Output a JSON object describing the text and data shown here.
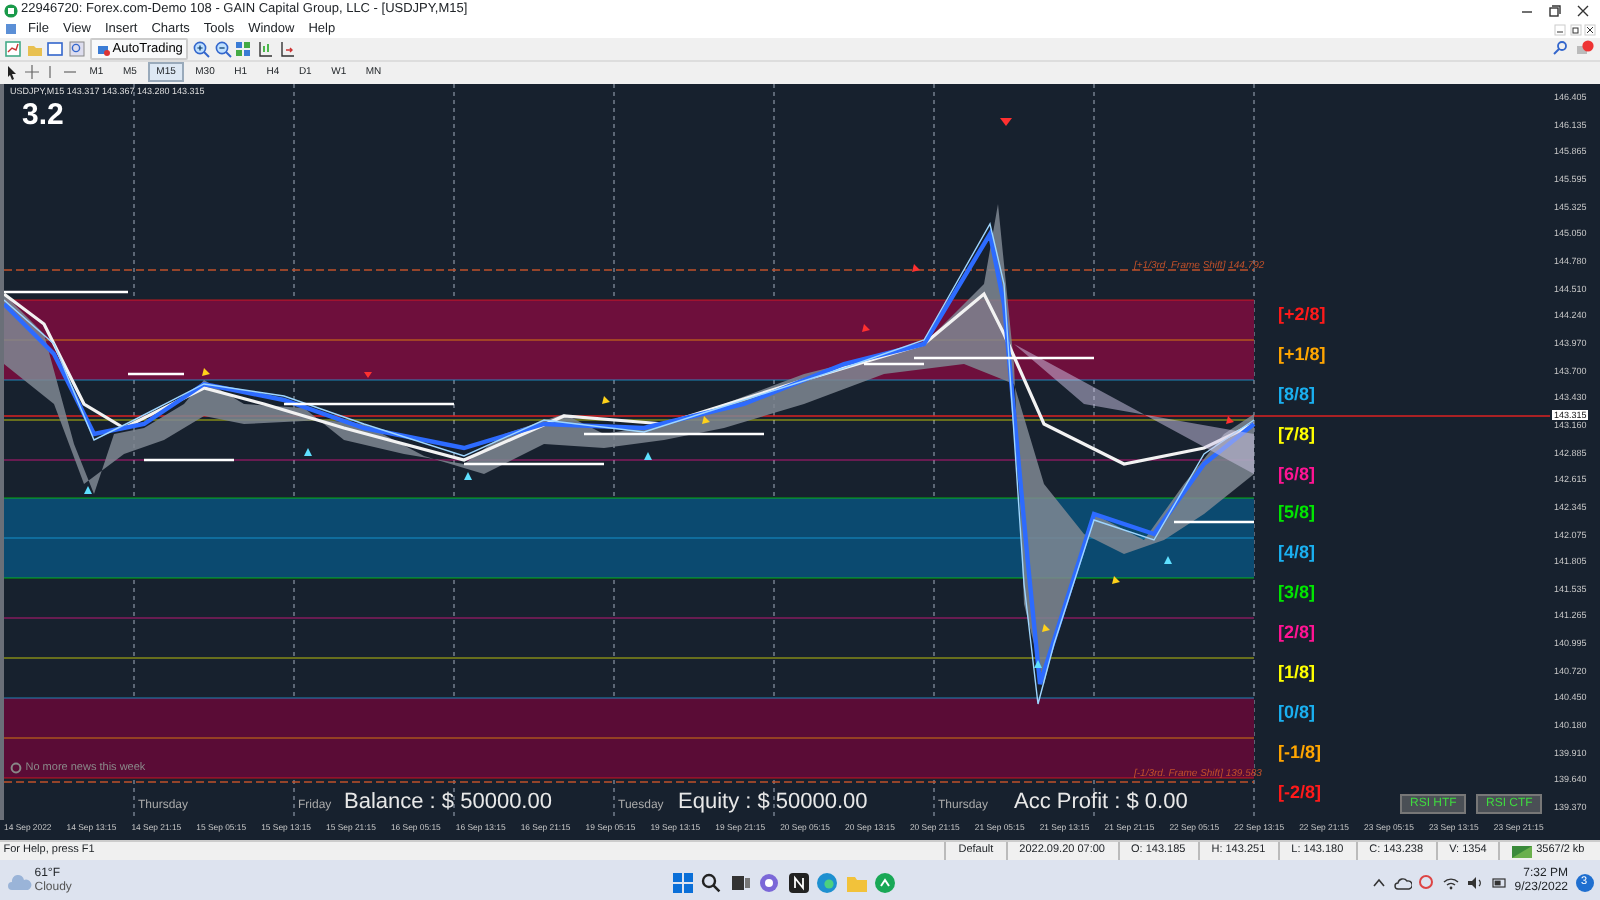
{
  "window": {
    "title": "22946720: Forex.com-Demo 108 - GAIN Capital Group, LLC - [USDJPY,M15]"
  },
  "menu": [
    "File",
    "View",
    "Insert",
    "Charts",
    "Tools",
    "Window",
    "Help"
  ],
  "toolbar": {
    "autotrading": "AutoTrading",
    "timeframes": [
      {
        "label": "M1",
        "selected": false
      },
      {
        "label": "M5",
        "selected": false
      },
      {
        "label": "M15",
        "selected": true
      },
      {
        "label": "M30",
        "selected": false
      },
      {
        "label": "H1",
        "selected": false
      },
      {
        "label": "H4",
        "selected": false
      },
      {
        "label": "D1",
        "selected": false
      },
      {
        "label": "W1",
        "selected": false
      },
      {
        "label": "MN",
        "selected": false
      }
    ]
  },
  "chart": {
    "header": "USDJPY,M15  143.317 143.367 143.280 143.315",
    "version": "3.2",
    "news": "No more news this week",
    "day_labels": [
      "Thursday",
      "Friday",
      "Tuesday",
      "Thursday"
    ],
    "frame_shift_top": "[+1/3rd. Frame Shift]  144.792",
    "frame_shift_bottom": "[-1/3rd. Frame Shift]  139.583",
    "levels": [
      {
        "label": "[+2/8]",
        "color": "#ff1a1a"
      },
      {
        "label": "[+1/8]",
        "color": "#ffa500"
      },
      {
        "label": "[8/8]",
        "color": "#1ab0f0"
      },
      {
        "label": "[7/8]",
        "color": "#ffff00"
      },
      {
        "label": "[6/8]",
        "color": "#ff1493"
      },
      {
        "label": "[5/8]",
        "color": "#00e600"
      },
      {
        "label": "[4/8]",
        "color": "#1ab0f0"
      },
      {
        "label": "[3/8]",
        "color": "#00e600"
      },
      {
        "label": "[2/8]",
        "color": "#ff1493"
      },
      {
        "label": "[1/8]",
        "color": "#ffff00"
      },
      {
        "label": "[0/8]",
        "color": "#1ab0f0"
      },
      {
        "label": "[-1/8]",
        "color": "#ffa500"
      },
      {
        "label": "[-2/8]",
        "color": "#ff1a1a"
      }
    ],
    "account": [
      "Balance : $ 50000.00",
      "Equity : $ 50000.00",
      "Acc Profit : $ 0.00"
    ],
    "buttons": [
      "RSI HTF",
      "RSI CTF"
    ],
    "price_axis": [
      "146.405",
      "146.135",
      "145.865",
      "145.595",
      "145.325",
      "145.050",
      "144.780",
      "144.510",
      "144.240",
      "143.970",
      "143.700",
      "143.430",
      "143.160",
      "142.885",
      "142.615",
      "142.345",
      "142.075",
      "141.805",
      "141.535",
      "141.265",
      "140.995",
      "140.720",
      "140.450",
      "140.180",
      "139.910",
      "139.640",
      "139.370"
    ],
    "current_price": "143.315",
    "time_axis": [
      "14 Sep 2022",
      "14 Sep 13:15",
      "14 Sep 21:15",
      "15 Sep 05:15",
      "15 Sep 13:15",
      "15 Sep 21:15",
      "16 Sep 05:15",
      "16 Sep 13:15",
      "16 Sep 21:15",
      "19 Sep 05:15",
      "19 Sep 13:15",
      "19 Sep 21:15",
      "20 Sep 05:15",
      "20 Sep 13:15",
      "20 Sep 21:15",
      "21 Sep 05:15",
      "21 Sep 13:15",
      "21 Sep 21:15",
      "22 Sep 05:15",
      "22 Sep 13:15",
      "22 Sep 21:15",
      "23 Sep 05:15",
      "23 Sep 13:15",
      "23 Sep 21:15"
    ]
  },
  "status_bar": {
    "help": "For Help, press F1",
    "profile": "Default",
    "time": "2022.09.20 07:00",
    "open": "O: 143.185",
    "high": "H: 143.251",
    "low": "L: 143.180",
    "close": "C: 143.238",
    "volume": "V: 1354",
    "traffic": "3567/2 kb"
  },
  "taskbar": {
    "temperature": "61°F",
    "weather": "Cloudy",
    "clock_time": "7:32 PM",
    "clock_date": "9/23/2022",
    "notifications": "3"
  }
}
